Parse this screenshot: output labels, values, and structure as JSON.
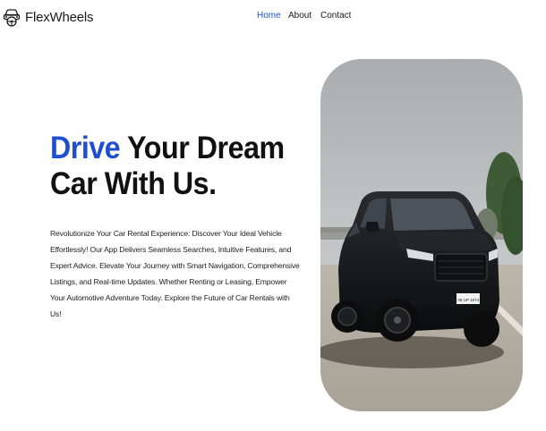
{
  "brand": {
    "name": "FlexWheels",
    "logo_icon": "car-steering-wheel-logo-icon"
  },
  "nav": {
    "items": [
      {
        "label": "Home",
        "active": true
      },
      {
        "label": "About",
        "active": false
      },
      {
        "label": "Contact",
        "active": false
      }
    ]
  },
  "hero": {
    "title_accent": "Drive",
    "title_rest_line1": " Your Dream",
    "title_line2": "Car With Us.",
    "description": "Revolutionize Your Car Rental Experience: Discover Your Ideal Vehicle Effortlessly! Our App Delivers Seamless Searches, Intuitive Features, and Expert Advice. Elevate Your Journey with Smart Navigation, Comprehensive Listings, and Real-time Updates. Whether Renting or Leasing, Empower Your Automotive Adventure Today. Explore the Future of Car Rentals with Us!",
    "image": {
      "name": "black-suv-photo",
      "plate_text": "TN 06 UP 1974 LA"
    }
  },
  "colors": {
    "accent": "#1f4fd1",
    "text": "#111111",
    "background": "#ffffff"
  }
}
